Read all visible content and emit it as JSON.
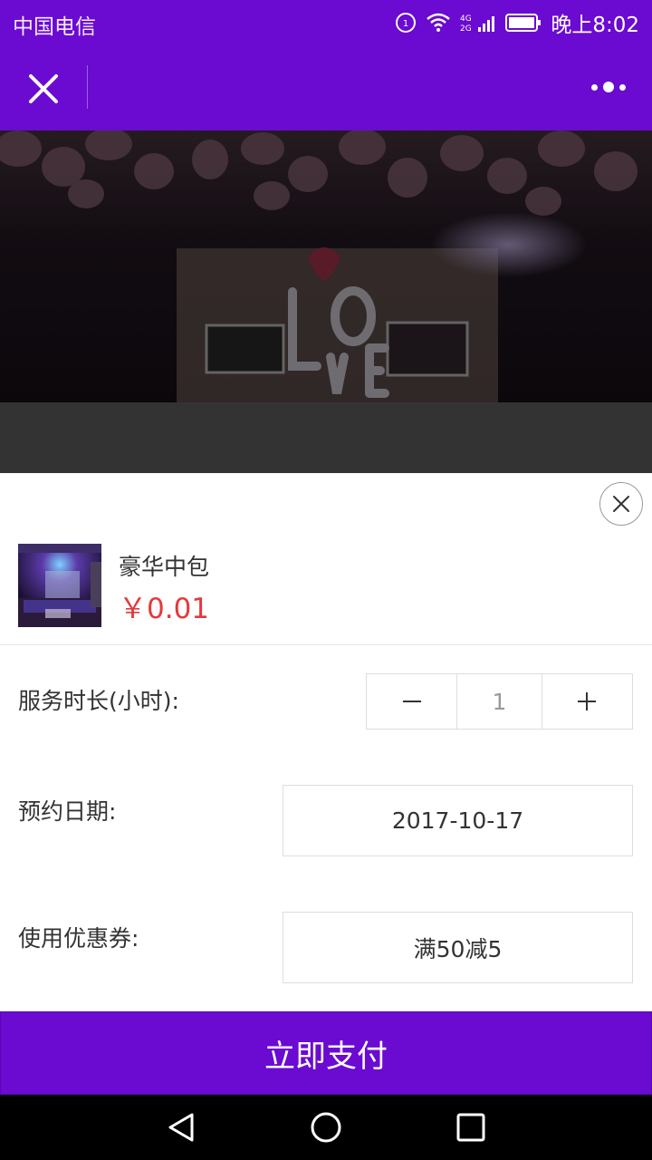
{
  "status_bar": {
    "carrier": "中国电信",
    "network": "4G 2G",
    "time": "晚上8:02"
  },
  "nav": {
    "close_icon": "close-icon",
    "more_icon": "more-icon"
  },
  "colors": {
    "brand": "#6b0ad1",
    "price": "#e4393c"
  },
  "sheet": {
    "product": {
      "name": "豪华中包",
      "price": "￥0.01"
    },
    "duration": {
      "label": "服务时长(小时):",
      "value": "1"
    },
    "date": {
      "label": "预约日期:",
      "value": "2017-10-17"
    },
    "coupon": {
      "label": "使用优惠券:",
      "value": "满50减5"
    }
  },
  "pay_button": {
    "label": "立即支付"
  }
}
